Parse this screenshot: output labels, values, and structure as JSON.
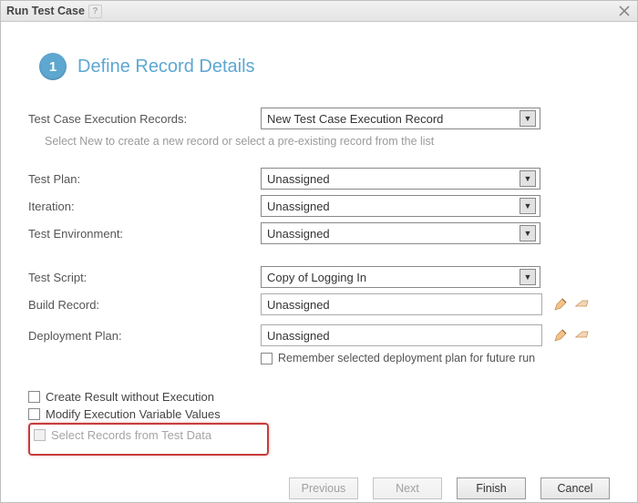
{
  "window": {
    "title": "Run Test Case"
  },
  "step": {
    "number": "1",
    "title": "Define Record Details"
  },
  "labels": {
    "exec_records": "Test Case Execution Records:",
    "helper": "Select New to create a new record or select a pre-existing record from the list",
    "test_plan": "Test Plan:",
    "iteration": "Iteration:",
    "test_env": "Test Environment:",
    "test_script": "Test Script:",
    "build_record": "Build Record:",
    "deploy_plan": "Deployment Plan:",
    "remember": "Remember selected deployment plan for future run",
    "cb_create_result": "Create Result without Execution",
    "cb_modify_vars": "Modify Execution Variable Values",
    "cb_select_records": "Select Records from Test Data"
  },
  "values": {
    "exec_records": "New Test Case Execution Record",
    "test_plan": "Unassigned",
    "iteration": "Unassigned",
    "test_env": "Unassigned",
    "test_script": "Copy of Logging In",
    "build_record": "Unassigned",
    "deploy_plan": "Unassigned"
  },
  "buttons": {
    "previous": "Previous",
    "next": "Next",
    "finish": "Finish",
    "cancel": "Cancel"
  }
}
